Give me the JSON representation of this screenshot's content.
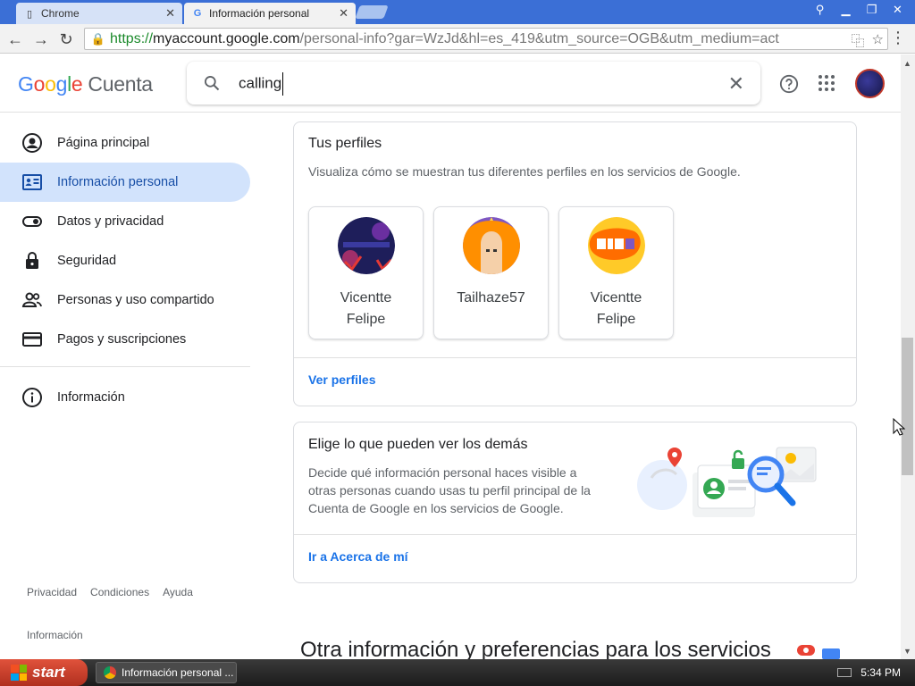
{
  "browser": {
    "tabs": [
      {
        "title": "Chrome",
        "active": false
      },
      {
        "title": "Información personal",
        "active": true
      }
    ],
    "url_scheme": "https://",
    "url_host": "myaccount.google.com",
    "url_rest": "/personal-info?gar=WzJd&hl=es_419&utm_source=OGB&utm_medium=act"
  },
  "header": {
    "brand": "Google",
    "brand_suffix": "Cuenta",
    "search_value": "calling"
  },
  "sidebar": {
    "items": [
      {
        "label": "Página principal",
        "icon": "account-circle-icon"
      },
      {
        "label": "Información personal",
        "icon": "id-card-icon",
        "active": true
      },
      {
        "label": "Datos y privacidad",
        "icon": "toggle-icon"
      },
      {
        "label": "Seguridad",
        "icon": "lock-icon"
      },
      {
        "label": "Personas y uso compartido",
        "icon": "people-icon"
      },
      {
        "label": "Pagos y suscripciones",
        "icon": "credit-card-icon"
      }
    ],
    "info_item": {
      "label": "Información",
      "icon": "info-icon"
    },
    "footer_links": [
      "Privacidad",
      "Condiciones",
      "Ayuda"
    ],
    "footer_info": "Información"
  },
  "profiles_card": {
    "title": "Tus perfiles",
    "description": "Visualiza cómo se muestran tus diferentes perfiles en los servicios de Google.",
    "profiles": [
      {
        "name": "Vicentte Felipe"
      },
      {
        "name": "Tailhaze57"
      },
      {
        "name": "Vicentte Felipe"
      }
    ],
    "link": "Ver perfiles"
  },
  "visibility_card": {
    "title": "Elige lo que pueden ver los demás",
    "description": "Decide qué información personal haces visible a otras personas cuando usas tu perfil principal de la Cuenta de Google en los servicios de Google.",
    "link": "Ir a Acerca de mí"
  },
  "section_heading": "Otra información y preferencias para los servicios",
  "taskbar": {
    "start": "start",
    "task": "Información personal ...",
    "time": "5:34 PM"
  },
  "colors": {
    "accent": "#1a73e8",
    "active_nav_bg": "#d2e3fc",
    "tabbar": "#3b6fd6"
  }
}
